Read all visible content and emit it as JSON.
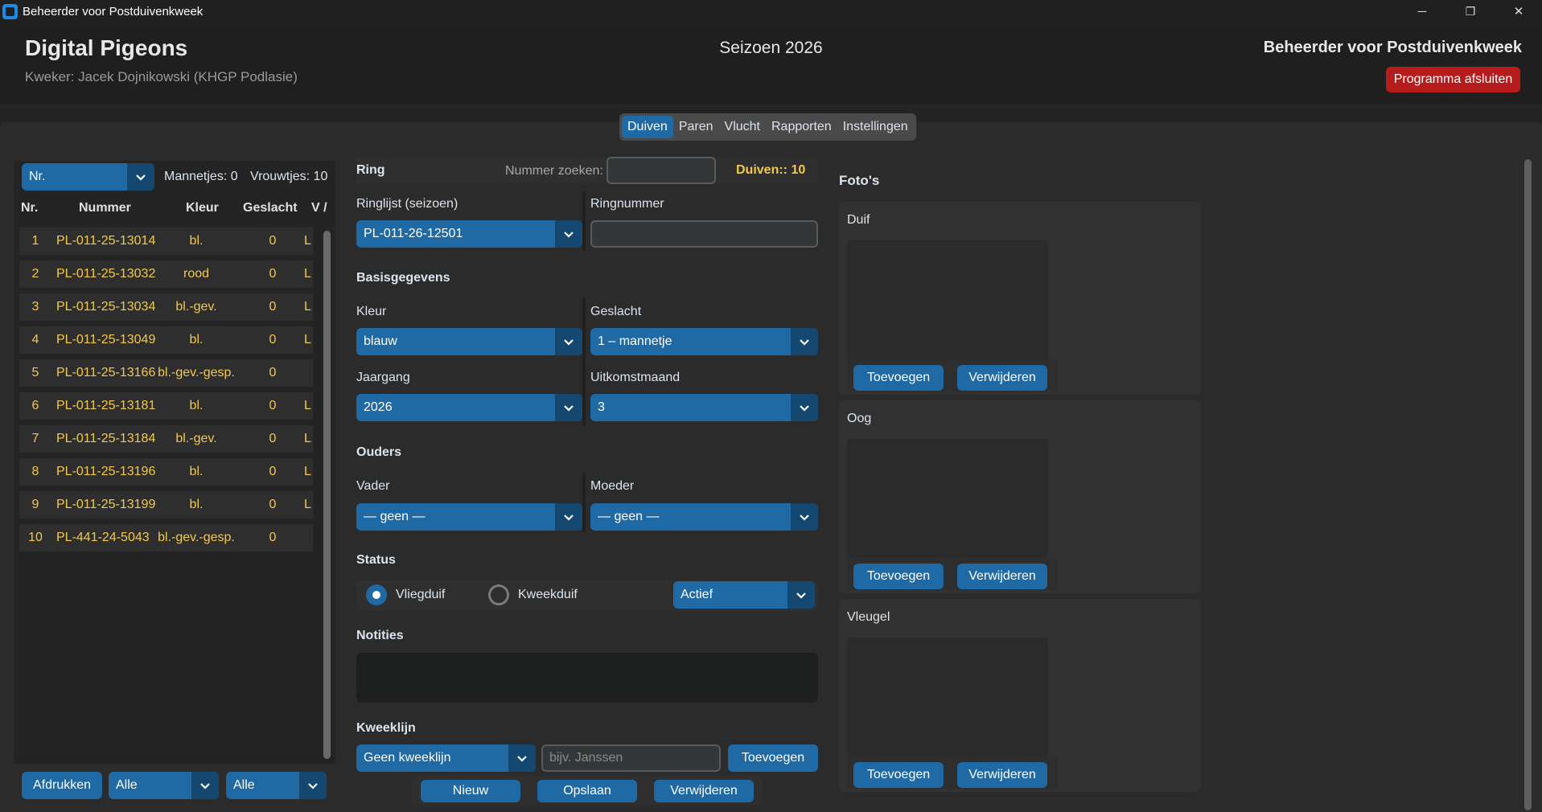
{
  "window": {
    "title": "Beheerder voor Postduivenkweek",
    "minimize": "─",
    "restore": "❐",
    "close": "✕"
  },
  "header": {
    "brand": "Digital Pigeons",
    "breeder": "Kweker: Jacek Dojnikowski (KHGP Podlasie)",
    "season": "Seizoen 2026",
    "app_title": "Beheerder voor Postduivenkweek",
    "quit_label": "Programma afsluiten"
  },
  "tabs": [
    {
      "label": "Duiven",
      "active": true
    },
    {
      "label": "Paren"
    },
    {
      "label": "Vlucht"
    },
    {
      "label": "Rapporten"
    },
    {
      "label": "Instellingen"
    }
  ],
  "list": {
    "sort_value": "Nr.",
    "males": "Mannetjes: 0",
    "females": "Vrouwtjes: 10",
    "columns": [
      "Nr.",
      "Nummer",
      "Kleur",
      "Geslacht",
      "V /"
    ],
    "rows": [
      {
        "nr": "1",
        "nummer": "PL-011-25-13014",
        "kleur": "bl.",
        "geslacht": "0",
        "v": "L"
      },
      {
        "nr": "2",
        "nummer": "PL-011-25-13032",
        "kleur": "rood",
        "geslacht": "0",
        "v": "L"
      },
      {
        "nr": "3",
        "nummer": "PL-011-25-13034",
        "kleur": "bl.-gev.",
        "geslacht": "0",
        "v": "L"
      },
      {
        "nr": "4",
        "nummer": "PL-011-25-13049",
        "kleur": "bl.",
        "geslacht": "0",
        "v": "L"
      },
      {
        "nr": "5",
        "nummer": "PL-011-25-13166",
        "kleur": "bl.-gev.-gesp.",
        "geslacht": "0",
        "v": ""
      },
      {
        "nr": "6",
        "nummer": "PL-011-25-13181",
        "kleur": "bl.",
        "geslacht": "0",
        "v": "L"
      },
      {
        "nr": "7",
        "nummer": "PL-011-25-13184",
        "kleur": "bl.-gev.",
        "geslacht": "0",
        "v": "L"
      },
      {
        "nr": "8",
        "nummer": "PL-011-25-13196",
        "kleur": "bl.",
        "geslacht": "0",
        "v": "L"
      },
      {
        "nr": "9",
        "nummer": "PL-011-25-13199",
        "kleur": "bl.",
        "geslacht": "0",
        "v": "L"
      },
      {
        "nr": "10",
        "nummer": "PL-441-24-5043",
        "kleur": "bl.-gev.-gesp.",
        "geslacht": "0",
        "v": ""
      }
    ],
    "print_label": "Afdrukken",
    "filter1": "Alle",
    "filter2": "Alle"
  },
  "form": {
    "ring_section": "Ring",
    "search_label": "Nummer zoeken:",
    "search_value": "",
    "count": "Duiven:: 10",
    "ringlist_label": "Ringlijst (seizoen)",
    "ringlist_value": "PL-011-26-12501",
    "ringnumber_label": "Ringnummer",
    "ringnumber_value": "",
    "basis_section": "Basisgegevens",
    "kleur_label": "Kleur",
    "kleur_value": "blauw",
    "geslacht_label": "Geslacht",
    "geslacht_value": "1 – mannetje",
    "jaargang_label": "Jaargang",
    "jaargang_value": "2026",
    "uitkomst_label": "Uitkomstmaand",
    "uitkomst_value": "3",
    "ouders_section": "Ouders",
    "vader_label": "Vader",
    "vader_value": "— geen —",
    "moeder_label": "Moeder",
    "moeder_value": "— geen —",
    "status_section": "Status",
    "radio1": "Vliegduif",
    "radio2": "Kweekduif",
    "status_value": "Actief",
    "notes_section": "Notities",
    "kweeklijn_section": "Kweeklijn",
    "kweeklijn_value": "Geen kweeklijn",
    "kweeklijn_placeholder": "bijv. Janssen",
    "kweeklijn_add": "Toevoegen",
    "new_label": "Nieuw",
    "save_label": "Opslaan",
    "delete_label": "Verwijderen"
  },
  "photos": {
    "title": "Foto's",
    "cards": [
      {
        "label": "Duif",
        "add": "Toevoegen",
        "remove": "Verwijderen"
      },
      {
        "label": "Oog",
        "add": "Toevoegen",
        "remove": "Verwijderen"
      },
      {
        "label": "Vleugel",
        "add": "Toevoegen",
        "remove": "Verwijderen"
      }
    ]
  },
  "colors": {
    "accent": "#1f6aa5",
    "accent_dark": "#144870",
    "danger": "#b71c1c",
    "highlight": "#f2c94c"
  }
}
